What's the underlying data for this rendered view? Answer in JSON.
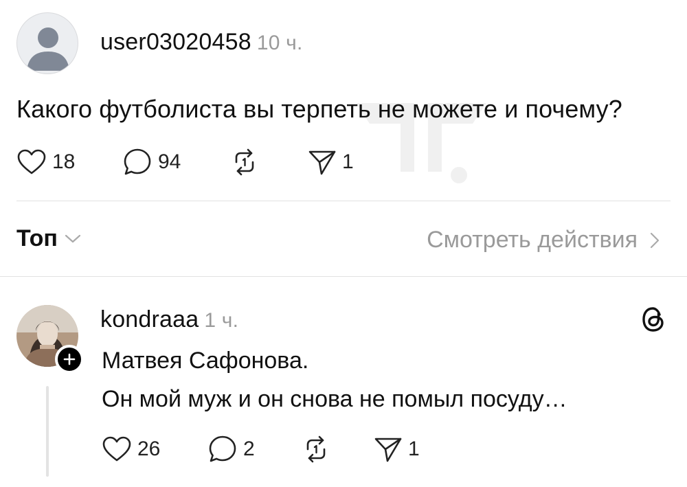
{
  "post": {
    "username": "user03020458",
    "time": "10 ч.",
    "text": "Какого футболиста вы терпеть не можете и почему?",
    "likes": "18",
    "comments": "94",
    "shares": "1"
  },
  "sort_bar": {
    "sort_label": "Топ",
    "activity_label": "Смотреть действия"
  },
  "reply": {
    "username": "kondraaa",
    "time": "1 ч.",
    "line1": "Матвея Сафонова.",
    "line2": "Он мой муж и он снова не помыл посуду…",
    "likes": "26",
    "comments": "2",
    "shares": "1"
  },
  "icons": {
    "like": "heart-icon",
    "comment": "comment-bubble-icon",
    "repost": "repost-icon",
    "share": "send-icon",
    "chevron_down": "chevron-down-icon",
    "chevron_right": "chevron-right-icon",
    "follow": "plus-icon",
    "app_logo": "threads-logo-icon"
  },
  "colors": {
    "text": "#111111",
    "muted": "#9a9a9a",
    "divider": "#e2e2e2"
  }
}
